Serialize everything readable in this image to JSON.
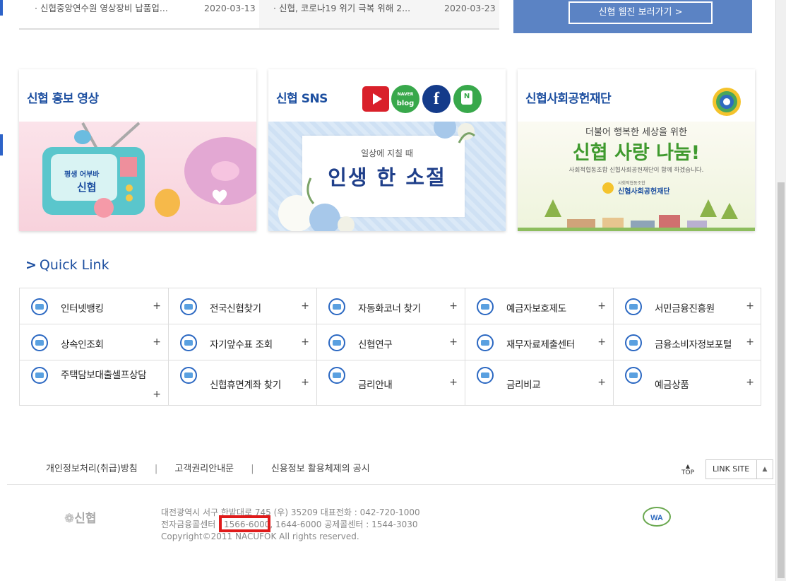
{
  "news": [
    {
      "title": "· 신협중앙연수원 영상장비 납품업...",
      "date": "2020-03-13"
    },
    {
      "title": "· 신협, 코로나19 위기 극복 위해 2...",
      "date": "2020-03-23"
    }
  ],
  "banner_top": {
    "button": "신협 웹진 보러가기 >"
  },
  "cards": {
    "video": {
      "title": "신협 홍보 영상",
      "tv_line1": "평생 어부바",
      "tv_line2": "신협"
    },
    "sns": {
      "title": "신협 SNS",
      "img_sub": "일상에 지칠 때",
      "img_main": "인생 한 소절",
      "icons": [
        "youtube-icon",
        "naver-blog-icon",
        "facebook-icon",
        "naver-post-icon"
      ],
      "icon_labels": {
        "naver_top": "NAVER",
        "naver_main": "blog",
        "naver_post": "N"
      }
    },
    "foundation": {
      "title": "신협사회공헌재단",
      "img_line1": "더불어 행복한 세상을 위한",
      "img_main": "신협 사랑 나눔!",
      "img_line2": "사회적협동조합 신협사회공헌재단이 함께 하겠습니다.",
      "img_logo_small": "사회적협동조합",
      "img_logo": "신협사회공헌재단"
    }
  },
  "quick_link": {
    "title": "Quick Link",
    "items": [
      {
        "label": "인터넷뱅킹",
        "icon": "won-coin-icon"
      },
      {
        "label": "전국신협찾기",
        "icon": "map-pin-icon"
      },
      {
        "label": "자동화코너 찾기",
        "icon": "atm-target-icon"
      },
      {
        "label": "예금자보호제도",
        "icon": "piggy-bank-icon"
      },
      {
        "label": "서민금융진흥원",
        "icon": "money-bag-icon"
      },
      {
        "label": "상속인조회",
        "icon": "people-search-icon"
      },
      {
        "label": "자기앞수표 조회",
        "icon": "check-document-icon"
      },
      {
        "label": "신협연구",
        "icon": "bar-chart-icon"
      },
      {
        "label": "재무자료제출센터",
        "icon": "ked-logo-icon"
      },
      {
        "label": "금융소비자정보포털",
        "icon": "fine-portal-icon"
      },
      {
        "label": "주택담보대출셀프상담",
        "icon": "house-plant-icon"
      },
      {
        "label": "신협휴면계좌 찾기",
        "icon": "dormant-account-icon"
      },
      {
        "label": "금리안내",
        "icon": "coins-stack-icon"
      },
      {
        "label": "금리비교",
        "icon": "compare-chart-icon"
      },
      {
        "label": "예금상품",
        "icon": "savings-product-icon"
      }
    ],
    "plus": "+"
  },
  "footer": {
    "links": [
      "개인정보처리(취급)방침",
      "고객권리안내문",
      "신용정보 활용체제의 공시"
    ],
    "separator": "|",
    "top": "TOP",
    "top_arrow": "▲",
    "link_site": "LINK SITE",
    "link_site_arrow": "▲",
    "logo": "❁신협",
    "address": "대전광역시 서구 한밭대로 745 (우) 35209 대표전화 : 042-720-1000",
    "phones": "전자금융콜센터 : 1566-6000, 1644-6000 공제콜센터 : 1544-3030",
    "copyright": "Copyright©2011 NACUFOK All rights reserved.",
    "wa_mark": "WA"
  },
  "colors": {
    "brand_blue": "#1d4fa0",
    "highlight_red": "#e01b1b"
  }
}
